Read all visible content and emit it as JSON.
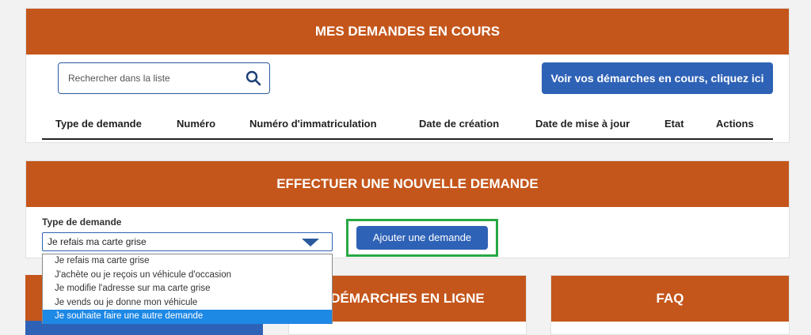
{
  "current_requests": {
    "title": "MES DEMANDES EN COURS",
    "search_placeholder": "Rechercher dans la liste",
    "demarches_button": "Voir vos démarches en cours, cliquez ici",
    "columns": [
      "Type de demande",
      "Numéro",
      "Numéro d'immatriculation",
      "Date de création",
      "Date de mise à jour",
      "Etat",
      "Actions"
    ]
  },
  "new_request": {
    "title": "EFFECTUER UNE NOUVELLE DEMANDE",
    "type_label": "Type de demande",
    "selected_value": "Je refais ma carte grise",
    "add_button": "Ajouter une demande",
    "options": [
      "Je refais ma carte grise",
      "J'achète ou je reçois un véhicule d'occasion",
      "Je modifie l'adresse sur ma carte grise",
      "Je vends ou je donne mon véhicule",
      "Je souhaite faire une autre demande"
    ],
    "highlighted_option_index": 4
  },
  "lower_panels": {
    "middle_title": "DÉMARCHES EN LIGNE",
    "faq_title": "FAQ"
  },
  "colors": {
    "header_orange": "#c4561b",
    "button_blue": "#2e62b6",
    "highlight_green": "#27a844",
    "option_highlight": "#1e88e5"
  }
}
